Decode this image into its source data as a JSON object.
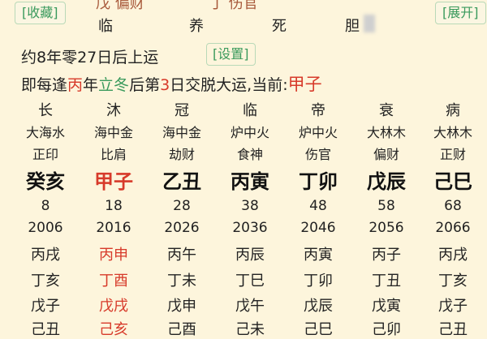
{
  "top": {
    "favorite_label": "[收藏]",
    "expand_label": "[展开]",
    "partial_left": "戊 偏财",
    "partial_right": "丁 伤官",
    "phases_row": [
      "临",
      "养",
      "死",
      "胆"
    ]
  },
  "info": {
    "start_luck_text": "约8年零27日后上运",
    "settings_label": "[设置]",
    "rule_prefix": "即每逢",
    "rule_stem": "丙",
    "rule_mid1": "年",
    "rule_term": "立冬",
    "rule_mid2": "后第",
    "rule_day": "3",
    "rule_suffix": "日交脱大运,当前:",
    "current_luck": "甲子"
  },
  "luck_columns": [
    {
      "phase": "长",
      "nayin": "大海水",
      "god": "正印",
      "pillar": "癸亥",
      "age": "8",
      "year": "2006",
      "years": [
        "丙戌",
        "丁亥",
        "戊子",
        "己丑"
      ],
      "pillar_highlight": false
    },
    {
      "phase": "沐",
      "nayin": "海中金",
      "god": "比肩",
      "pillar": "甲子",
      "age": "18",
      "year": "2016",
      "years": [
        "丙申",
        "丁酉",
        "戊戌",
        "己亥"
      ],
      "pillar_highlight": true
    },
    {
      "phase": "冠",
      "nayin": "海中金",
      "god": "劫财",
      "pillar": "乙丑",
      "age": "28",
      "year": "2026",
      "years": [
        "丙午",
        "丁未",
        "戊申",
        "己酉"
      ],
      "pillar_highlight": false
    },
    {
      "phase": "临",
      "nayin": "炉中火",
      "god": "食神",
      "pillar": "丙寅",
      "age": "38",
      "year": "2036",
      "years": [
        "丙辰",
        "丁巳",
        "戊午",
        "己未"
      ],
      "pillar_highlight": false
    },
    {
      "phase": "帝",
      "nayin": "炉中火",
      "god": "伤官",
      "pillar": "丁卯",
      "age": "48",
      "year": "2046",
      "years": [
        "丙寅",
        "丁卯",
        "戊辰",
        "己巳"
      ],
      "pillar_highlight": false
    },
    {
      "phase": "衰",
      "nayin": "大林木",
      "god": "偏财",
      "pillar": "戊辰",
      "age": "58",
      "year": "2056",
      "years": [
        "丙子",
        "丁丑",
        "戊寅",
        "己卯"
      ],
      "pillar_highlight": false
    },
    {
      "phase": "病",
      "nayin": "大林木",
      "god": "正财",
      "pillar": "己巳",
      "age": "68",
      "year": "2066",
      "years": [
        "丙戌",
        "丁亥",
        "戊子",
        "己丑"
      ],
      "pillar_highlight": false
    }
  ],
  "colors": {
    "accent_red": "#d73a2a",
    "accent_green": "#3a9a5c",
    "background": "#fdf5dc"
  }
}
